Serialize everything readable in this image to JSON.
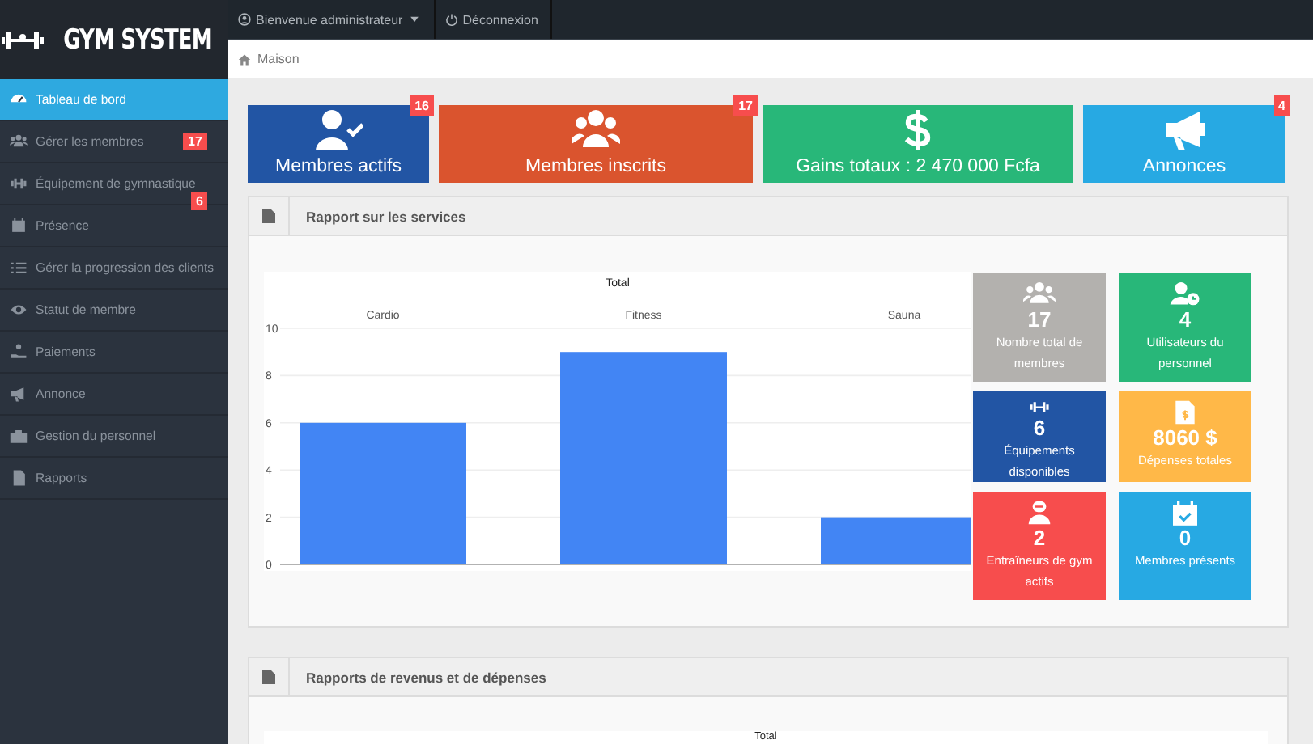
{
  "logo": {
    "text": "GYM SYSTEM"
  },
  "topbar": {
    "user_menu": "Bienvenue administrateur",
    "logout": "Déconnexion"
  },
  "breadcrumb": {
    "label": "Maison"
  },
  "sidebar": {
    "items": [
      {
        "label": "Tableau de bord",
        "selected": true
      },
      {
        "label": "Gérer les membres",
        "selected": false,
        "badge": "17"
      },
      {
        "label": "Équipement de gymnastique",
        "selected": false,
        "badge": "6"
      },
      {
        "label": "Présence",
        "selected": false
      },
      {
        "label": "Gérer la progression des clients",
        "selected": false
      },
      {
        "label": "Statut de membre",
        "selected": false
      },
      {
        "label": "Paiements",
        "selected": false
      },
      {
        "label": "Annonce",
        "selected": false
      },
      {
        "label": "Gestion du personnel",
        "selected": false
      },
      {
        "label": "Rapports",
        "selected": false
      }
    ]
  },
  "stat_cards": [
    {
      "label": "Membres actifs",
      "badge": "16",
      "color": "#2255a4"
    },
    {
      "label": "Membres inscrits",
      "badge": "17",
      "color": "#da542e"
    },
    {
      "label": "Gains totaux : 2 470 000 Fcfa",
      "color": "#28b779"
    },
    {
      "label": "Annonces",
      "badge": "4",
      "color": "#27a9e3"
    }
  ],
  "services_report": {
    "title": "Rapport sur les services",
    "chart_data": {
      "type": "bar",
      "grid": true,
      "categories": [
        "Cardio",
        "Fitness",
        "Sauna"
      ],
      "series": [
        {
          "name": "Total",
          "color": "#4285f4",
          "values": [
            6,
            9,
            2
          ]
        }
      ],
      "ylim": [
        0,
        10
      ],
      "yticks": [
        0,
        2,
        4,
        6,
        8,
        10
      ]
    },
    "tiles": [
      {
        "value": "17",
        "label": "Nombre total de membres",
        "color": "#b3b1ae"
      },
      {
        "value": "4",
        "label": "Utilisateurs du personnel",
        "color": "#28b779"
      },
      {
        "value": "6",
        "label": "Équipements disponibles",
        "color": "#2255a4"
      },
      {
        "value": "8060 $",
        "label": "Dépenses totales",
        "color": "#ffb848"
      },
      {
        "value": "2",
        "label": "Entraîneurs de gym actifs",
        "color": "#f74d4d"
      },
      {
        "value": "0",
        "label": "Membres présents",
        "color": "#27a9e3"
      }
    ]
  },
  "income_report": {
    "title": "Rapports de revenus et de dépenses",
    "chart_title": "Total"
  }
}
